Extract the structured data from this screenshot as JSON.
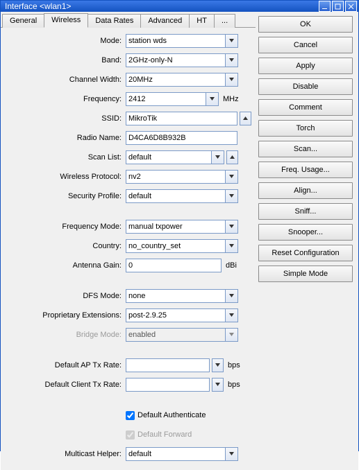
{
  "window": {
    "title": "Interface <wlan1>"
  },
  "tabs": {
    "items": [
      "General",
      "Wireless",
      "Data Rates",
      "Advanced",
      "HT",
      "..."
    ],
    "active": 1
  },
  "side_buttons": {
    "ok": "OK",
    "cancel": "Cancel",
    "apply": "Apply",
    "disable": "Disable",
    "comment": "Comment",
    "torch": "Torch",
    "scan": "Scan...",
    "freq_usage": "Freq. Usage...",
    "align": "Align...",
    "sniff": "Sniff...",
    "snooper": "Snooper...",
    "reset": "Reset Configuration",
    "simple": "Simple Mode"
  },
  "form": {
    "mode": {
      "label": "Mode:",
      "value": "station wds"
    },
    "band": {
      "label": "Band:",
      "value": "2GHz-only-N"
    },
    "channel_width": {
      "label": "Channel Width:",
      "value": "20MHz"
    },
    "frequency": {
      "label": "Frequency:",
      "value": "2412",
      "unit": "MHz"
    },
    "ssid": {
      "label": "SSID:",
      "value": "MikroTik"
    },
    "radio_name": {
      "label": "Radio Name:",
      "value": "D4CA6D8B932B"
    },
    "scan_list": {
      "label": "Scan List:",
      "value": "default"
    },
    "wireless_proto": {
      "label": "Wireless Protocol:",
      "value": "nv2"
    },
    "security_profile": {
      "label": "Security Profile:",
      "value": "default"
    },
    "frequency_mode": {
      "label": "Frequency Mode:",
      "value": "manual txpower"
    },
    "country": {
      "label": "Country:",
      "value": "no_country_set"
    },
    "antenna_gain": {
      "label": "Antenna Gain:",
      "value": "0",
      "unit": "dBi"
    },
    "dfs_mode": {
      "label": "DFS Mode:",
      "value": "none"
    },
    "prop_ext": {
      "label": "Proprietary Extensions:",
      "value": "post-2.9.25"
    },
    "bridge_mode": {
      "label": "Bridge Mode:",
      "value": "enabled"
    },
    "ap_tx_rate": {
      "label": "Default AP Tx Rate:",
      "value": "",
      "unit": "bps"
    },
    "client_tx_rate": {
      "label": "Default Client Tx Rate:",
      "value": "",
      "unit": "bps"
    },
    "default_auth": {
      "label": "Default Authenticate",
      "checked": true
    },
    "default_fwd": {
      "label": "Default Forward",
      "checked": true
    },
    "multicast_helper": {
      "label": "Multicast Helper:",
      "value": "default"
    }
  }
}
